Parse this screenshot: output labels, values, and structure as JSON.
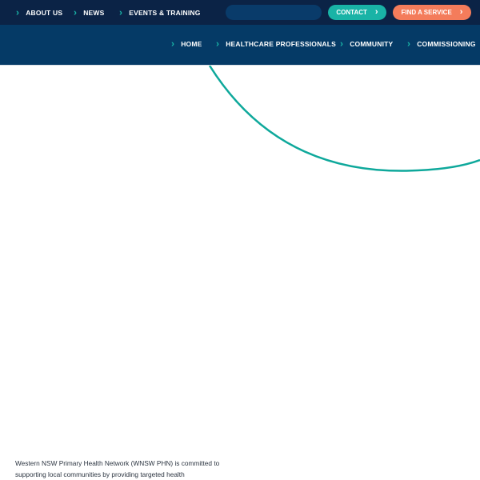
{
  "topbar": {
    "links": [
      {
        "label": "ABOUT US"
      },
      {
        "label": "NEWS"
      },
      {
        "label": "EVENTS & TRAINING"
      }
    ],
    "search": {
      "placeholder": ""
    },
    "contact_label": "CONTACT",
    "find_service_label": "FIND A SERVICE"
  },
  "mainnav": {
    "links": [
      {
        "label": "HOME"
      },
      {
        "label": "HEALTHCARE PROFESSIONALS"
      },
      {
        "label": "COMMUNITY"
      },
      {
        "label": "COMMISSIONING"
      }
    ]
  },
  "intro": {
    "text": "Western NSW Primary Health Network (WNSW PHN) is committed to supporting local communities by providing targeted health"
  },
  "colors": {
    "topbar": "#0b2346",
    "mainnav": "#053a66",
    "teal": "#19b3a6",
    "orange": "#f47c5b",
    "arc": "#0ea89b"
  },
  "icons": {
    "nav_chevron": "chevron-right-icon"
  }
}
